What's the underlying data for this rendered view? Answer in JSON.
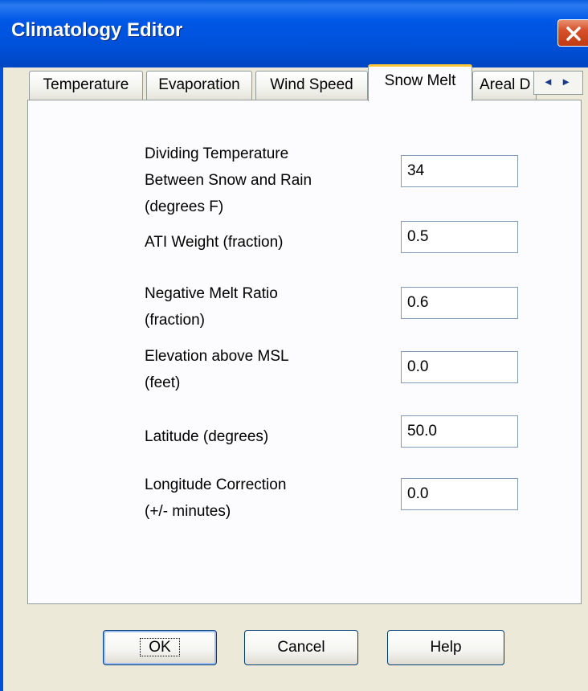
{
  "window": {
    "title": "Climatology Editor"
  },
  "tabs": [
    {
      "label": "Temperature",
      "selected": false
    },
    {
      "label": "Evaporation",
      "selected": false
    },
    {
      "label": "Wind Speed",
      "selected": false
    },
    {
      "label": "Snow Melt",
      "selected": true
    },
    {
      "label": "Areal D",
      "selected": false
    }
  ],
  "tab_scroll": {
    "left_icon": "chevron-left-icon",
    "right_icon": "chevron-right-icon"
  },
  "fields": [
    {
      "label": "Dividing Temperature\nBetween Snow and Rain\n(degrees F)",
      "value": "34"
    },
    {
      "label": "ATI Weight (fraction)",
      "value": "0.5"
    },
    {
      "label": "Negative Melt Ratio\n(fraction)",
      "value": "0.6"
    },
    {
      "label": "Elevation above MSL\n(feet)",
      "value": "0.0"
    },
    {
      "label": "Latitude (degrees)",
      "value": "50.0"
    },
    {
      "label": "Longitude Correction\n(+/- minutes)",
      "value": "0.0"
    }
  ],
  "buttons": {
    "ok": "OK",
    "cancel": "Cancel",
    "help": "Help"
  },
  "colors": {
    "titlebar": "#0050d8",
    "accent_tab": "#ffc83c",
    "close": "#d6502a"
  }
}
